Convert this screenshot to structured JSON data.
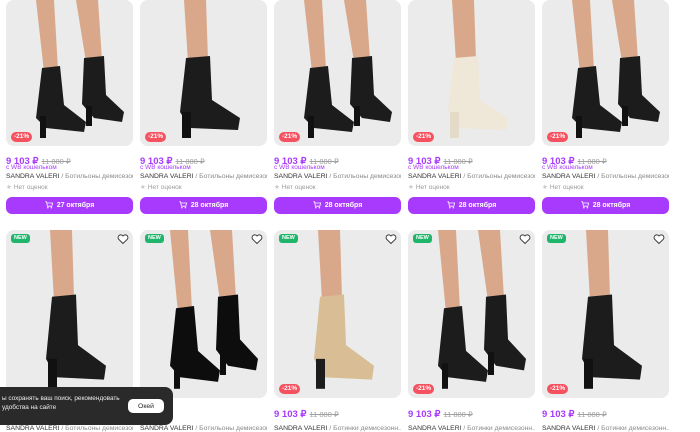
{
  "products_row1": [
    {
      "discount": "-21%",
      "price": "9 103 ₽",
      "old_price": "11 880 ₽",
      "wallet": "с WB кошельком",
      "brand": "SANDRA VALERI",
      "name": " / Ботильоны демисезон...",
      "rating": "Нет оценок",
      "delivery": "27 октября",
      "boot": "black"
    },
    {
      "discount": "-21%",
      "price": "9 103 ₽",
      "old_price": "11 880 ₽",
      "wallet": "с WB кошельком",
      "brand": "SANDRA VALERI",
      "name": " / Ботильоны демисезон...",
      "rating": "Нет оценок",
      "delivery": "28 октября",
      "boot": "black"
    },
    {
      "discount": "-21%",
      "price": "9 103 ₽",
      "old_price": "11 880 ₽",
      "wallet": "с WB кошельком",
      "brand": "SANDRA VALERI",
      "name": " / Ботильоны демисезон...",
      "rating": "Нет оценок",
      "delivery": "28 октября",
      "boot": "black"
    },
    {
      "discount": "-21%",
      "price": "9 103 ₽",
      "old_price": "11 880 ₽",
      "wallet": "с WB кошельком",
      "brand": "SANDRA VALERI",
      "name": " / Ботильоны демисезон...",
      "rating": "Нет оценок",
      "delivery": "28 октября",
      "boot": "cream"
    },
    {
      "discount": "-21%",
      "price": "9 103 ₽",
      "old_price": "11 880 ₽",
      "wallet": "с WB кошельком",
      "brand": "SANDRA VALERI",
      "name": " / Ботильоны демисезон...",
      "rating": "Нет оценок",
      "delivery": "28 октября",
      "boot": "black"
    }
  ],
  "products_row2": [
    {
      "badge": "NEW",
      "discount": "",
      "price": "",
      "old_price": "",
      "brand": "SANDRA VALERI",
      "name": " / Ботильоны демисезон...",
      "boot": "black"
    },
    {
      "badge": "NEW",
      "discount": "",
      "price": "",
      "old_price": "",
      "brand": "SANDRA VALERI",
      "name": " / Ботильоны демисезон...",
      "boot": "patent"
    },
    {
      "badge": "NEW",
      "discount": "-21%",
      "price": "9 103 ₽",
      "old_price": "11 880 ₽",
      "brand": "SANDRA VALERI",
      "name": " / Ботинки демисезонн...",
      "boot": "beige"
    },
    {
      "badge": "NEW",
      "discount": "-21%",
      "price": "9 103 ₽",
      "old_price": "11 880 ₽",
      "brand": "SANDRA VALERI",
      "name": " / Ботинки демисезонн...",
      "boot": "black"
    },
    {
      "badge": "NEW",
      "discount": "-21%",
      "price": "9 103 ₽",
      "old_price": "11 880 ₽",
      "brand": "SANDRA VALERI",
      "name": " / Ботинки демисезонн...",
      "boot": "black"
    }
  ],
  "cookie": {
    "text": "ы сохранять ваш поиск, рекомендовать\nудобства на сайте",
    "button": "Окей"
  },
  "colors": {
    "accent": "#a73afd",
    "discount": "#f5515f",
    "new": "#1fb66b"
  },
  "icons": {
    "cart": "cart-icon",
    "heart": "heart-icon",
    "star": "star-icon"
  }
}
